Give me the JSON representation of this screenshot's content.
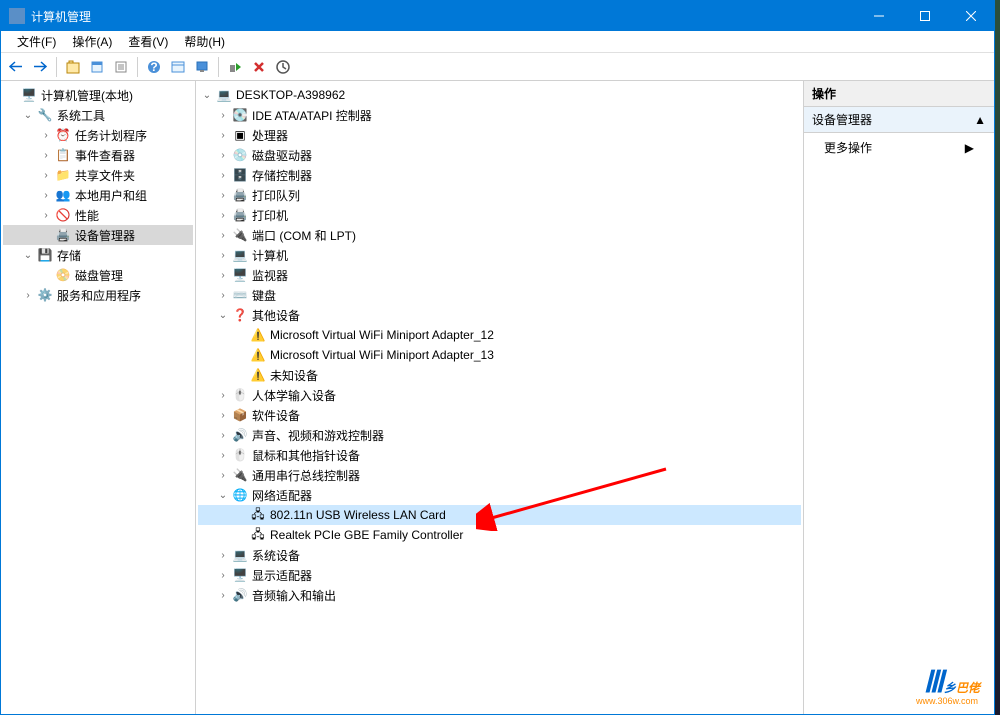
{
  "window": {
    "title": "计算机管理"
  },
  "menu": {
    "file": "文件(F)",
    "action": "操作(A)",
    "view": "查看(V)",
    "help": "帮助(H)"
  },
  "leftTree": {
    "root": "计算机管理(本地)",
    "sysTools": "系统工具",
    "task": "任务计划程序",
    "event": "事件查看器",
    "shared": "共享文件夹",
    "users": "本地用户和组",
    "perf": "性能",
    "devmgr": "设备管理器",
    "storage": "存储",
    "disk": "磁盘管理",
    "services": "服务和应用程序"
  },
  "deviceTree": {
    "root": "DESKTOP-A398962",
    "ide": "IDE ATA/ATAPI 控制器",
    "cpu": "处理器",
    "diskdrive": "磁盘驱动器",
    "storagectrl": "存储控制器",
    "printq": "打印队列",
    "printer": "打印机",
    "ports": "端口 (COM 和 LPT)",
    "computer": "计算机",
    "monitor": "监视器",
    "keyboard": "键盘",
    "other": "其他设备",
    "wifi12": "Microsoft Virtual WiFi Miniport Adapter_12",
    "wifi13": "Microsoft Virtual WiFi Miniport Adapter_13",
    "unknown": "未知设备",
    "hid": "人体学输入设备",
    "software": "软件设备",
    "sound": "声音、视频和游戏控制器",
    "mouse": "鼠标和其他指针设备",
    "usb": "通用串行总线控制器",
    "network": "网络适配器",
    "wlan": "802.11n USB Wireless LAN Card",
    "realtek": "Realtek PCIe GBE Family Controller",
    "system": "系统设备",
    "display": "显示适配器",
    "audio": "音频输入和输出"
  },
  "actions": {
    "header": "操作",
    "section": "设备管理器",
    "more": "更多操作"
  },
  "watermark": {
    "text1": "乡",
    "text2": "巴佬",
    "url": "www.306w.com"
  }
}
